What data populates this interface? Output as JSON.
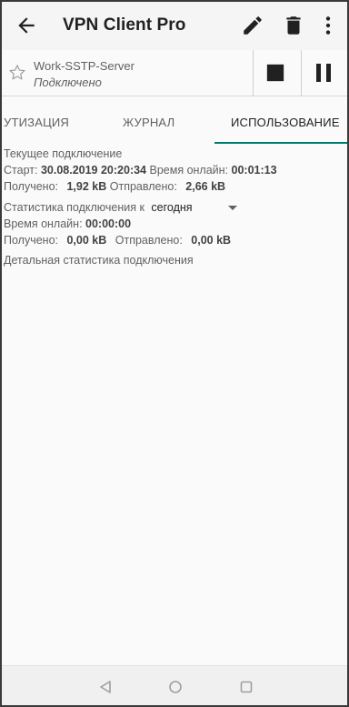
{
  "app": {
    "title": "VPN Client Pro"
  },
  "icons": {
    "back": "arrow-back-icon",
    "edit": "pencil-icon",
    "delete": "trash-icon",
    "more": "more-vertical-icon",
    "favorite": "star-outline-icon",
    "stop": "stop-icon",
    "pause": "pause-icon"
  },
  "connection": {
    "name": "Work-SSTP-Server",
    "status": "Подключено"
  },
  "tabs": [
    {
      "label": "УТИЗАЦИЯ",
      "active": false
    },
    {
      "label": "ЖУРНАЛ",
      "active": false
    },
    {
      "label": "ИСПОЛЬЗОВАНИЕ",
      "active": true
    }
  ],
  "current": {
    "heading": "Текущее подключение",
    "start_label": "Старт:",
    "start_value": "30.08.2019 20:20:34",
    "online_label": "Время онлайн:",
    "online_value": "00:01:13",
    "received_label": "Получено:",
    "received_value": "1,92 kB",
    "sent_label": "Отправлено:",
    "sent_value": "2,66 kB"
  },
  "stats": {
    "label": "Статистика подключения к",
    "period": "сегодня",
    "online_label": "Время онлайн:",
    "online_value": "00:00:00",
    "received_label": "Получено:",
    "received_value": "0,00 kB",
    "sent_label": "Отправлено:",
    "sent_value": "0,00 kB",
    "detail_link": "Детальная статистика подключения"
  },
  "colors": {
    "accent": "#00796b",
    "appbar_bg": "#f5f5f5",
    "text_primary": "#212121",
    "text_secondary": "#616161"
  }
}
